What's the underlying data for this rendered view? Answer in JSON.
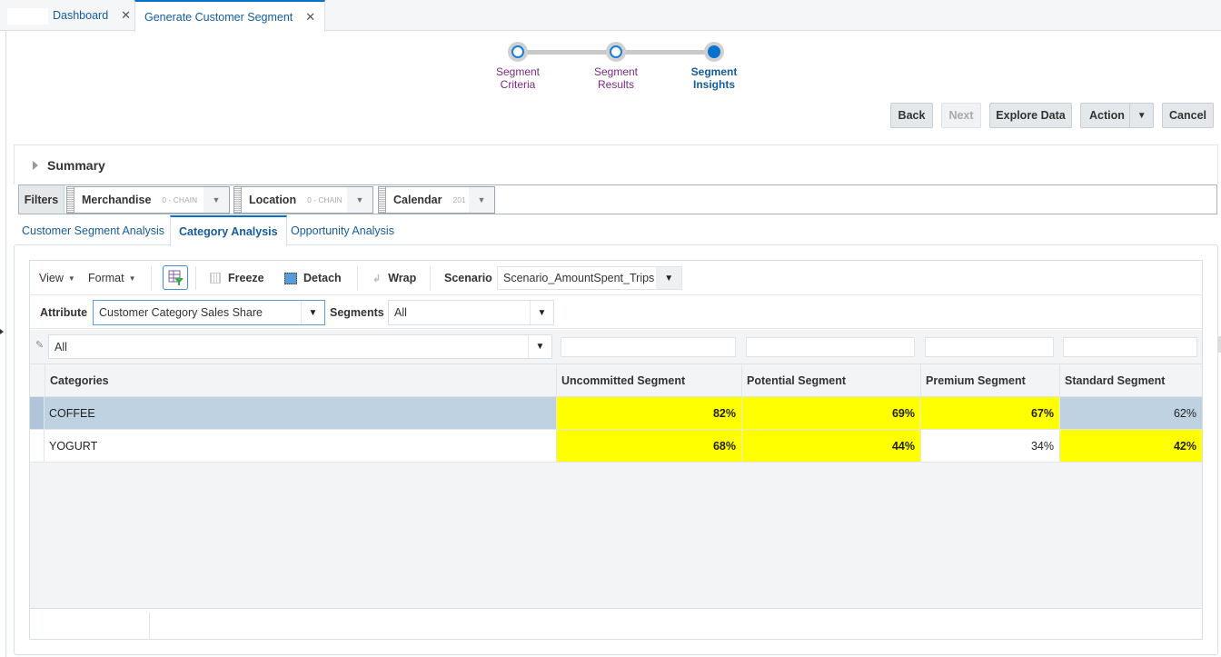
{
  "tabs": [
    {
      "label": "Dashboard",
      "active": false
    },
    {
      "label": "Generate Customer Segment",
      "active": true
    }
  ],
  "train": [
    {
      "line1": "Segment",
      "line2": "Criteria",
      "state": "visited"
    },
    {
      "line1": "Segment",
      "line2": "Results",
      "state": "visited"
    },
    {
      "line1": "Segment",
      "line2": "Insights",
      "state": "current"
    }
  ],
  "actions": {
    "back": "Back",
    "next": "Next",
    "explore": "Explore Data",
    "action": "Action",
    "cancel": "Cancel"
  },
  "summary": {
    "title": "Summary"
  },
  "filters": {
    "label": "Filters",
    "items": [
      {
        "name": "Merchandise",
        "value": "0 - CHAIN"
      },
      {
        "name": "Location",
        "value": "0 - CHAIN"
      },
      {
        "name": "Calendar",
        "value": "201"
      }
    ]
  },
  "subtabs": [
    {
      "label": "Customer Segment Analysis",
      "active": false
    },
    {
      "label": "Category Analysis",
      "active": true
    },
    {
      "label": "Opportunity Analysis",
      "active": false
    }
  ],
  "toolbar": {
    "view": "View",
    "format": "Format",
    "freeze": "Freeze",
    "detach": "Detach",
    "wrap": "Wrap",
    "scenario_label": "Scenario",
    "scenario_value": "Scenario_AmountSpent_Trips"
  },
  "attributes": {
    "attribute_label": "Attribute",
    "attribute_value": "Customer Category Sales Share",
    "segments_label": "Segments",
    "segments_value": "All"
  },
  "table": {
    "category_filter": "All",
    "columns": [
      "Categories",
      "Uncommitted Segment",
      "Potential Segment",
      "Premium Segment",
      "Standard Segment"
    ],
    "rows": [
      {
        "category": "COFFEE",
        "selected": true,
        "values": [
          "82%",
          "69%",
          "67%",
          "62%"
        ],
        "highlight": [
          true,
          true,
          true,
          false
        ]
      },
      {
        "category": "YOGURT",
        "selected": false,
        "values": [
          "68%",
          "44%",
          "34%",
          "42%"
        ],
        "highlight": [
          true,
          true,
          false,
          true
        ]
      }
    ],
    "highlight_color": "#ffff00",
    "selected_row_color": "#bfd2e2"
  }
}
